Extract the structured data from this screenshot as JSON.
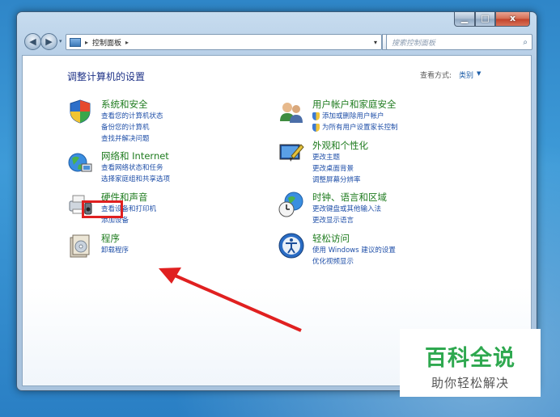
{
  "window": {
    "caption_buttons": {
      "minimize": "▁",
      "maximize": "□",
      "close": "x"
    }
  },
  "nav": {
    "back_glyph": "◀",
    "forward_glyph": "▶",
    "history_glyph": "▾",
    "breadcrumb": "控制面板",
    "sep_glyph": "▸",
    "dropdown_glyph": "▾",
    "refresh_glyph": "↻",
    "search_placeholder": "搜索控制面板",
    "search_glyph": "⌕"
  },
  "content": {
    "title": "调整计算机的设置",
    "view_by_label": "查看方式:",
    "view_by_value": "类别",
    "view_by_arrow": "▼"
  },
  "categories": [
    {
      "icon": "system-security-icon",
      "title": "系统和安全",
      "links": [
        "查看您的计算机状态",
        "备份您的计算机",
        "查找并解决问题"
      ]
    },
    {
      "icon": "network-internet-icon",
      "title": "网络和 Internet",
      "links": [
        "查看网络状态和任务",
        "选择家庭组和共享选项"
      ]
    },
    {
      "icon": "hardware-sound-icon",
      "title": "硬件和声音",
      "links": [
        "查看设备和打印机",
        "添加设备"
      ]
    },
    {
      "icon": "programs-icon",
      "title": "程序",
      "links": [
        "卸载程序"
      ]
    },
    {
      "icon": "user-accounts-icon",
      "title": "用户帐户和家庭安全",
      "links": [
        "添加或删除用户帐户",
        "为所有用户设置家长控制"
      ]
    },
    {
      "icon": "appearance-icon",
      "title": "外观和个性化",
      "links": [
        "更改主题",
        "更改桌面背景",
        "调整屏幕分辨率"
      ]
    },
    {
      "icon": "clock-language-icon",
      "title": "时钟、语言和区域",
      "links": [
        "更改键盘或其他输入法",
        "更改显示语言"
      ]
    },
    {
      "icon": "ease-of-access-icon",
      "title": "轻松访问",
      "links": [
        "使用 Windows 建议的设置",
        "优化视频显示"
      ]
    }
  ],
  "watermark": {
    "title": "百科全说",
    "subtitle": "助你轻松解决"
  },
  "colors": {
    "highlight": "#e02020",
    "watermark_green": "#2ea84f"
  }
}
